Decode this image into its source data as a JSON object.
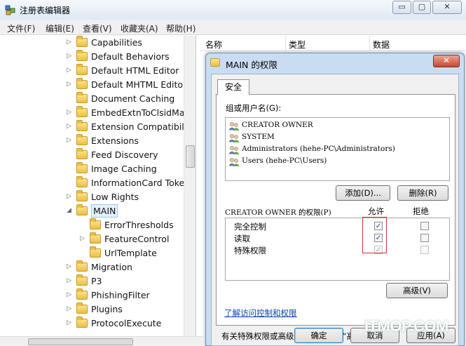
{
  "window": {
    "title": "注册表编辑器",
    "controls": {
      "minimize": "▭",
      "maximize": "▢",
      "close": "✕"
    }
  },
  "menu": [
    "文件(F)",
    "编辑(E)",
    "查看(V)",
    "收藏夹(A)",
    "帮助(H)"
  ],
  "tree": {
    "items": [
      {
        "label": "Capabilities",
        "indent": 1,
        "expander": "right"
      },
      {
        "label": "Default Behaviors",
        "indent": 1,
        "expander": "right"
      },
      {
        "label": "Default HTML Editor",
        "indent": 1,
        "expander": "right"
      },
      {
        "label": "Default MHTML Editor",
        "indent": 1,
        "expander": "right"
      },
      {
        "label": "Document Caching",
        "indent": 1,
        "expander": "none"
      },
      {
        "label": "EmbedExtnToClsidMap",
        "indent": 1,
        "expander": "right"
      },
      {
        "label": "Extension Compatibility",
        "indent": 1,
        "expander": "right"
      },
      {
        "label": "Extensions",
        "indent": 1,
        "expander": "right"
      },
      {
        "label": "Feed Discovery",
        "indent": 1,
        "expander": "none"
      },
      {
        "label": "Image Caching",
        "indent": 1,
        "expander": "none"
      },
      {
        "label": "InformationCard Tokens",
        "indent": 1,
        "expander": "none"
      },
      {
        "label": "Low Rights",
        "indent": 1,
        "expander": "right"
      },
      {
        "label": "MAIN",
        "indent": 1,
        "expander": "down",
        "selected": true
      },
      {
        "label": "ErrorThresholds",
        "indent": 2,
        "expander": "none"
      },
      {
        "label": "FeatureControl",
        "indent": 2,
        "expander": "right"
      },
      {
        "label": "UrlTemplate",
        "indent": 2,
        "expander": "none"
      },
      {
        "label": "Migration",
        "indent": 1,
        "expander": "right"
      },
      {
        "label": "P3",
        "indent": 1,
        "expander": "right"
      },
      {
        "label": "PhishingFilter",
        "indent": 1,
        "expander": "right"
      },
      {
        "label": "Plugins",
        "indent": 1,
        "expander": "right"
      },
      {
        "label": "ProtocolExecute",
        "indent": 1,
        "expander": "right"
      }
    ]
  },
  "list_header": {
    "name": "名称",
    "type": "类型",
    "data": "数据"
  },
  "dialog": {
    "title": "MAIN 的权限",
    "close": "✕",
    "tab": "安全",
    "users_label": "组或用户名(G):",
    "users": [
      "CREATOR OWNER",
      "SYSTEM",
      "Administrators (hehe-PC\\Administrators)",
      "Users (hehe-PC\\Users)"
    ],
    "add_button": "添加(D)...",
    "remove_button": "删除(R)",
    "perm_label": "CREATOR OWNER 的权限(P)",
    "allow_header": "允许",
    "deny_header": "拒绝",
    "permissions": [
      {
        "name": "完全控制",
        "allow": true,
        "deny": false,
        "disabled": false
      },
      {
        "name": "读取",
        "allow": true,
        "deny": false,
        "disabled": false
      },
      {
        "name": "特殊权限",
        "allow": true,
        "deny": false,
        "disabled": true
      }
    ],
    "advanced_note": "有关特殊权限或高级设置，请单击“高级”。",
    "advanced_button": "高级(V)",
    "learn_link": "了解访问控制和权限",
    "ok_button": "确定",
    "cancel_button": "取消",
    "apply_button": "应用(A)"
  },
  "watermark": "ITMOP.COM",
  "colors": {
    "accent": "#3399ff",
    "highlight_box": "#e03030",
    "link": "#0645ad"
  }
}
